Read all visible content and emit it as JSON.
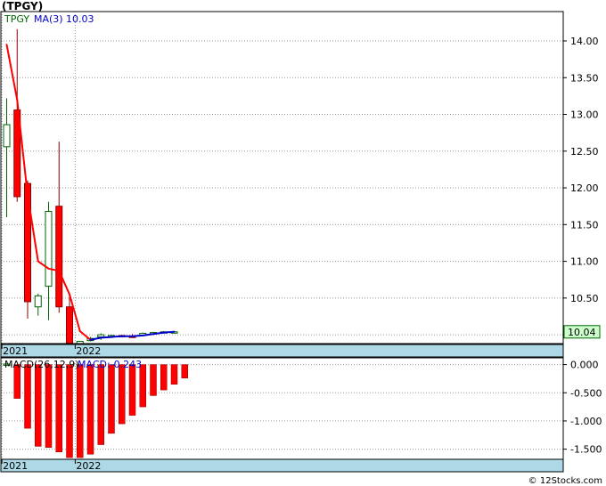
{
  "title": "(TPGY)",
  "footer": "© 12Stocks.com",
  "colors": {
    "up_body": "#ffffff",
    "up_edge": "#006400",
    "down_body": "#ff0000",
    "down_edge": "#8b0000",
    "ma_down": "#ff0000",
    "ma_up": "#0000cc",
    "axis_band": "#add8e6",
    "last_label_bg": "#ccffcc",
    "macd_hist": "#ff0000"
  },
  "chart_data": [
    {
      "type": "candlestick",
      "legend": {
        "symbol": "TPGY",
        "ma_label": "MA(3)",
        "ma_value": "10.03"
      },
      "ylim": [
        9.88,
        14.4
      ],
      "y_ticks": [
        "14.00",
        "13.50",
        "13.00",
        "12.50",
        "12.00",
        "11.50",
        "11.00",
        "10.50",
        "10.00"
      ],
      "last_price_label": "10.04",
      "x_labels": [
        {
          "label": "2021",
          "index": 0
        },
        {
          "label": "2022",
          "index": 7
        }
      ],
      "candles": [
        {
          "o": 12.56,
          "h": 13.22,
          "l": 11.6,
          "c": 12.86
        },
        {
          "o": 13.06,
          "h": 14.16,
          "l": 11.81,
          "c": 11.88
        },
        {
          "o": 12.06,
          "h": 12.1,
          "l": 10.22,
          "c": 10.45
        },
        {
          "o": 10.38,
          "h": 10.56,
          "l": 10.26,
          "c": 10.53
        },
        {
          "o": 10.66,
          "h": 11.81,
          "l": 10.2,
          "c": 11.68
        },
        {
          "o": 11.75,
          "h": 12.63,
          "l": 10.3,
          "c": 10.38
        },
        {
          "o": 10.38,
          "h": 10.56,
          "l": 9.88,
          "c": 9.88
        },
        {
          "o": 9.88,
          "h": 9.91,
          "l": 9.88,
          "c": 9.91
        },
        {
          "o": 9.92,
          "h": 9.97,
          "l": 9.91,
          "c": 9.95
        },
        {
          "o": 9.97,
          "h": 10.02,
          "l": 9.93,
          "c": 10.0
        },
        {
          "o": 9.99,
          "h": 10.0,
          "l": 9.97,
          "c": 9.99
        },
        {
          "o": 9.99,
          "h": 10.0,
          "l": 9.97,
          "c": 9.98
        },
        {
          "o": 9.98,
          "h": 10.01,
          "l": 9.96,
          "c": 9.97
        },
        {
          "o": 9.99,
          "h": 10.03,
          "l": 9.98,
          "c": 10.02
        },
        {
          "o": 10.01,
          "h": 10.04,
          "l": 10.0,
          "c": 10.03
        },
        {
          "o": 10.03,
          "h": 10.05,
          "l": 10.02,
          "c": 10.04
        },
        {
          "o": 10.04,
          "h": 10.05,
          "l": 10.02,
          "c": 10.04
        }
      ],
      "ma": [
        13.95,
        13.2,
        11.9,
        11.0,
        10.9,
        10.87,
        10.55,
        10.05,
        9.93,
        9.96,
        9.97,
        9.98,
        9.98,
        9.99,
        10.01,
        10.03,
        10.04
      ]
    },
    {
      "type": "bar",
      "legend": {
        "label": "MACD(26,12,9)",
        "value_label": "MACD:-0.243"
      },
      "ylim": [
        -1.68,
        0.12
      ],
      "y_ticks": [
        "0.000",
        "-0.500",
        "-1.000",
        "-1.500"
      ],
      "x_labels": [
        {
          "label": "2021",
          "index": 0
        },
        {
          "label": "2022",
          "index": 7
        }
      ],
      "values": [
        0.01,
        -0.6,
        -1.13,
        -1.45,
        -1.47,
        -1.55,
        -1.65,
        -1.65,
        -1.59,
        -1.42,
        -1.22,
        -1.05,
        -0.9,
        -0.75,
        -0.55,
        -0.45,
        -0.35,
        -0.24
      ]
    }
  ]
}
